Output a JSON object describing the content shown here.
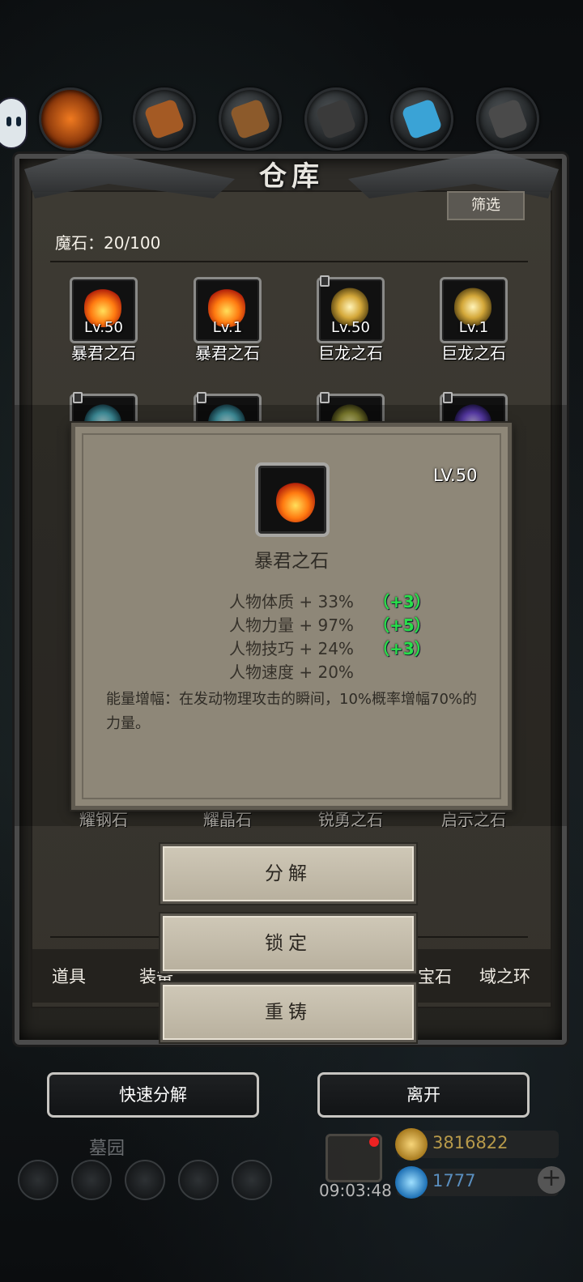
{
  "warehouse": {
    "title": "仓库",
    "filter_label": "筛选",
    "stone_count": "魔石：20/100"
  },
  "grid": {
    "row1": [
      {
        "level": "Lv.50",
        "name": "暴君之石",
        "gem": "fire-stone-icon",
        "locked": false
      },
      {
        "level": "Lv.1",
        "name": "暴君之石",
        "gem": "fire-stone-icon",
        "locked": false
      },
      {
        "level": "Lv.50",
        "name": "巨龙之石",
        "gem": "dragon-stone-icon",
        "locked": true
      },
      {
        "level": "Lv.1",
        "name": "巨龙之石",
        "gem": "dragon-stone-icon",
        "locked": false
      }
    ],
    "row_partial_names": [
      "耀钢石",
      "耀晶石",
      "锐勇之石",
      "启示之石"
    ]
  },
  "tabs": [
    "道具",
    "装备",
    "宝石",
    "域之环"
  ],
  "detail": {
    "level": "LV.50",
    "name": "暴君之石",
    "stats": [
      {
        "text": "人物体质 + 33%",
        "bonus": "（+3）"
      },
      {
        "text": "人物力量 + 97%",
        "bonus": "（+5）"
      },
      {
        "text": "人物技巧 + 24%",
        "bonus": "（+3）"
      },
      {
        "text": "人物速度 + 20%",
        "bonus": ""
      }
    ],
    "skill": "能量增幅：在发动物理攻击的瞬间，10%概率增幅70%的力量。"
  },
  "actions": {
    "decompose": "分解",
    "lock": "锁定",
    "recast": "重铸"
  },
  "bottom": {
    "quick_decompose": "快速分解",
    "leave": "离开",
    "scene": "墓园",
    "timer": "09:03:48",
    "gold": "3816822",
    "diamonds": "1777",
    "plus": "+"
  },
  "colors": {
    "bonus_green": "#28e04a",
    "dialog_bg": "#8e8778",
    "panel_bg": "#3d3a33"
  }
}
